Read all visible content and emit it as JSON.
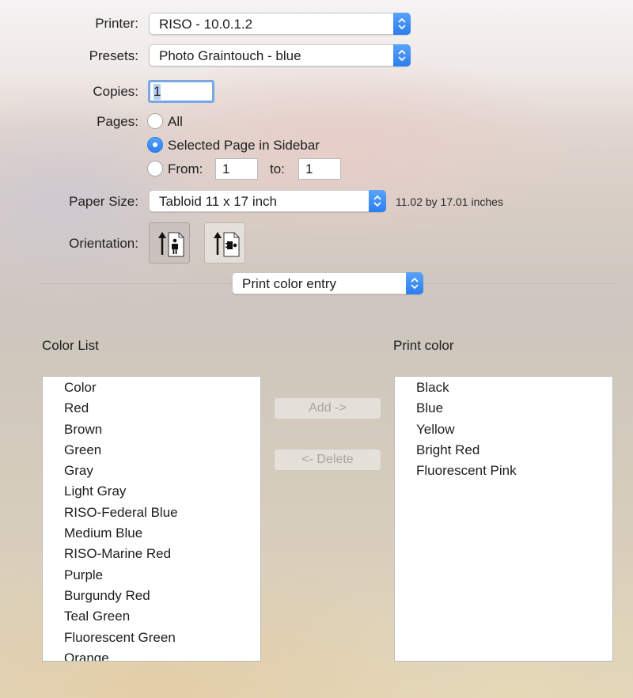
{
  "printer": {
    "label": "Printer:",
    "value": "RISO - 10.0.1.2"
  },
  "presets": {
    "label": "Presets:",
    "value": "Photo Graintouch - blue"
  },
  "copies": {
    "label": "Copies:",
    "value": "1"
  },
  "pages": {
    "label": "Pages:",
    "all_label": "All",
    "selected_label": "Selected Page in Sidebar",
    "from_label": "From:",
    "from_value": "1",
    "to_label": "to:",
    "to_value": "1",
    "selected_option": "Selected Page in Sidebar"
  },
  "paper_size": {
    "label": "Paper Size:",
    "value": "Tabloid 11 x 17 inch",
    "dimensions": "11.02 by 17.01 inches"
  },
  "orientation": {
    "label": "Orientation:",
    "options": [
      "portrait",
      "landscape"
    ],
    "selected": "portrait"
  },
  "section_popup": {
    "value": "Print color entry"
  },
  "color_list": {
    "title": "Color List",
    "items": [
      "Color",
      "Red",
      "Brown",
      "Green",
      "Gray",
      "Light Gray",
      "RISO-Federal Blue",
      "Medium Blue",
      "RISO-Marine Red",
      "Purple",
      "Burgundy Red",
      "Teal Green",
      "Fluorescent Green",
      "Orange"
    ]
  },
  "buttons": {
    "add": "Add ->",
    "delete": "<- Delete"
  },
  "print_color": {
    "title": "Print color",
    "items": [
      "Black",
      "Blue",
      "Yellow",
      "Bright Red",
      "Fluorescent Pink"
    ]
  },
  "colors": {
    "accent": "#2b7ef0",
    "focus_ring": "#6fa1e8"
  }
}
